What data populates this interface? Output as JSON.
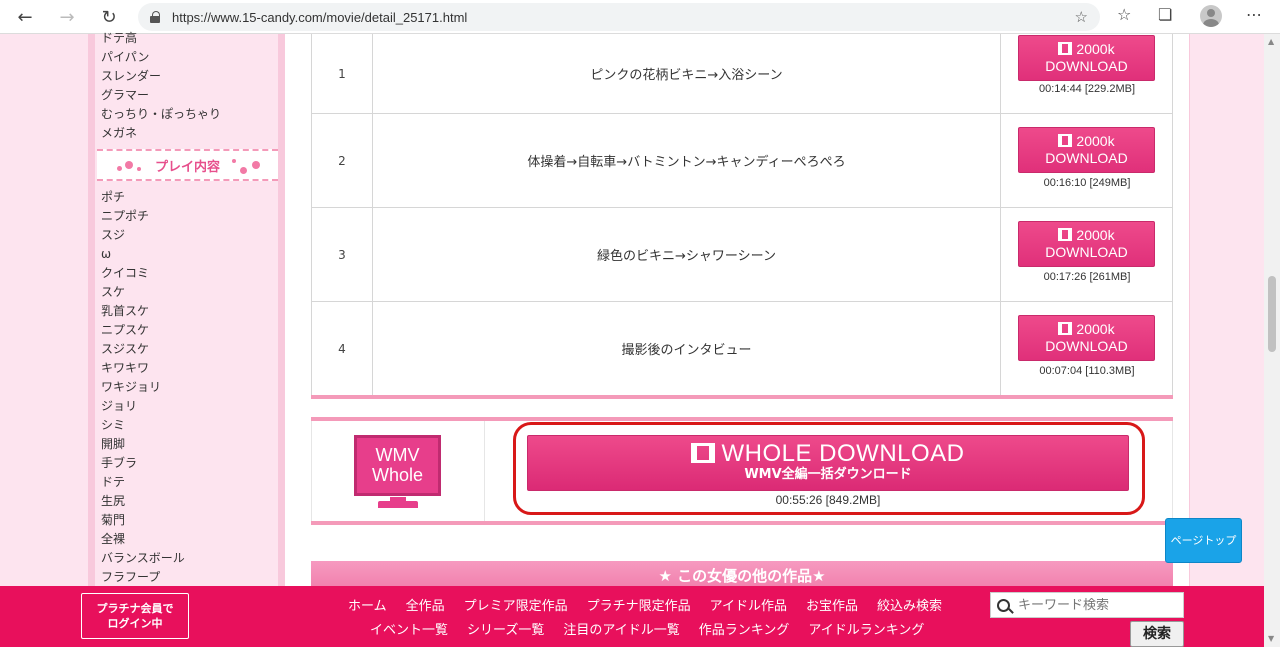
{
  "browser": {
    "url": "https://www.15-candy.com/movie/detail_25171.html"
  },
  "sidebar": {
    "top_items": [
      "ドテ高",
      "パイパン",
      "スレンダー",
      "グラマー",
      "むっちり・ぽっちゃり",
      "メガネ"
    ],
    "section_header": "プレイ内容",
    "play_items": [
      "ポチ",
      "ニプポチ",
      "スジ",
      "ω",
      "クイコミ",
      "スケ",
      "乳首スケ",
      "ニプスケ",
      "スジスケ",
      "キワキワ",
      "ワキジョリ",
      "ジョリ",
      "シミ",
      "開脚",
      "手ブラ",
      "ドテ",
      "生尻",
      "菊門",
      "全裸",
      "バランスボール",
      "フラフープ"
    ]
  },
  "chapters": [
    {
      "num": "1",
      "title": "ピンクの花柄ビキニ→入浴シーン",
      "btn_top": "2000k",
      "btn_bottom": "DOWNLOAD",
      "meta": "00:14:44 [229.2MB]"
    },
    {
      "num": "2",
      "title": "体操着→自転車→バトミントン→キャンディーぺろぺろ",
      "btn_top": "2000k",
      "btn_bottom": "DOWNLOAD",
      "meta": "00:16:10 [249MB]"
    },
    {
      "num": "3",
      "title": "緑色のビキニ→シャワーシーン",
      "btn_top": "2000k",
      "btn_bottom": "DOWNLOAD",
      "meta": "00:17:26 [261MB]"
    },
    {
      "num": "4",
      "title": "撮影後のインタビュー",
      "btn_top": "2000k",
      "btn_bottom": "DOWNLOAD",
      "meta": "00:07:04 [110.3MB]"
    }
  ],
  "whole": {
    "icon_line1": "WMV",
    "icon_line2": "Whole",
    "button_title": "WHOLE DOWNLOAD",
    "button_sub": "WMV全編一括ダウンロード",
    "meta": "00:55:26 [849.2MB]"
  },
  "other_works": "★ この女優の他の作品★",
  "page_top": "ページトップ",
  "footer": {
    "login_line1": "プラチナ会員で",
    "login_line2": "ログイン中",
    "nav_row1": [
      "ホーム",
      "全作品",
      "プレミア限定作品",
      "プラチナ限定作品",
      "アイドル作品",
      "お宝作品",
      "絞込み検索"
    ],
    "nav_row2": [
      "イベント一覧",
      "シリーズ一覧",
      "注目のアイドル一覧",
      "作品ランキング",
      "アイドルランキング"
    ],
    "search_placeholder": "キーワード検索",
    "search_button": "検索"
  },
  "colors": {
    "accent": "#e8105c",
    "button": "#e73e8b",
    "highlight": "#d81818",
    "page_top": "#1aa3e8"
  }
}
